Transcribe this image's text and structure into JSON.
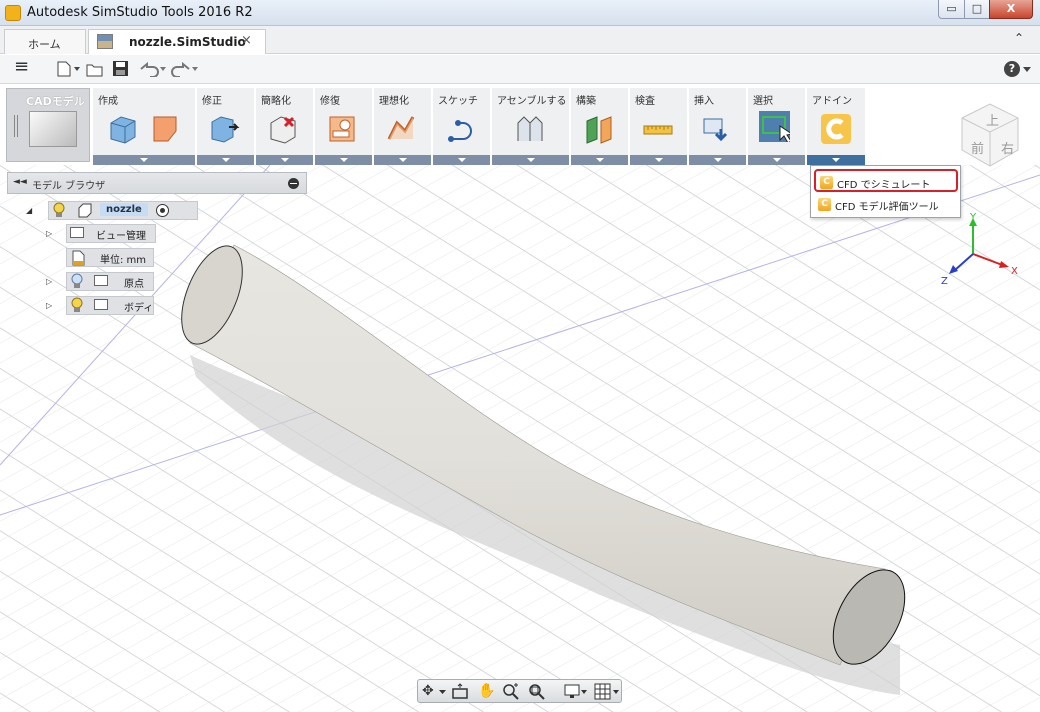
{
  "window": {
    "title": "Autodesk SimStudio Tools 2016 R2",
    "min_glyph": "▭",
    "max_glyph": "□",
    "close_glyph": "X"
  },
  "tabs": {
    "home": "ホーム",
    "document": "nozzle.SimStudio",
    "close_glyph": "×",
    "collapse_glyph": "⌃"
  },
  "qat": {
    "menu_glyph": "≡",
    "help_glyph": "?"
  },
  "workspace": {
    "label": "CADモデル"
  },
  "ribbon_groups": [
    {
      "label": "作成",
      "icon": "create-box-icon"
    },
    {
      "label": "修正",
      "icon": "modify-icon"
    },
    {
      "label": "簡略化",
      "icon": "simplify-icon"
    },
    {
      "label": "修復",
      "icon": "repair-icon"
    },
    {
      "label": "理想化",
      "icon": "idealize-icon"
    },
    {
      "label": "スケッチ",
      "icon": "sketch-icon"
    },
    {
      "label": "アセンブルする",
      "icon": "assemble-icon"
    },
    {
      "label": "構築",
      "icon": "construct-icon"
    },
    {
      "label": "検査",
      "icon": "inspect-icon"
    },
    {
      "label": "挿入",
      "icon": "insert-icon"
    },
    {
      "label": "選択",
      "icon": "select-icon"
    },
    {
      "label": "アドイン",
      "icon": "addin-icon"
    }
  ],
  "addin_menu": [
    {
      "label": "CFD でシミュレート",
      "icon": "cfd-icon",
      "highlighted": true
    },
    {
      "label": "CFD モデル評価ツール",
      "icon": "cfd-icon",
      "highlighted": false
    }
  ],
  "browser": {
    "title": "モデル ブラウザ",
    "collapse_glyph": "◄◄",
    "root": "nozzle",
    "items": [
      {
        "label": "ビュー管理"
      },
      {
        "label": "単位: mm"
      },
      {
        "label": "原点"
      },
      {
        "label": "ボディ"
      }
    ]
  },
  "viewcube": {
    "top": "上",
    "front": "前",
    "right": "右"
  },
  "triad": {
    "x": "X",
    "y": "Y",
    "z": "Z"
  },
  "accent_colors": {
    "ribbon_dropdown": "#7d8ea6",
    "highlight": "#d8202a",
    "addin_orange": "#f2a51d",
    "selected_tree": "#c6dcf5"
  }
}
